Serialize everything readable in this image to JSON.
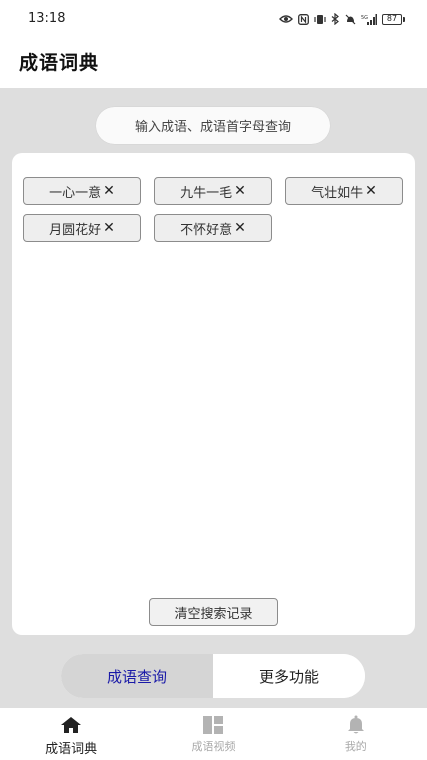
{
  "status_bar": {
    "time": "13:18",
    "battery": "87"
  },
  "header": {
    "title": "成语词典"
  },
  "search": {
    "placeholder": "输入成语、成语首字母查询"
  },
  "history": {
    "tags": [
      {
        "label": "一心一意"
      },
      {
        "label": "九牛一毛"
      },
      {
        "label": "气壮如牛"
      },
      {
        "label": "月圆花好"
      },
      {
        "label": "不怀好意"
      }
    ],
    "close_glyph": "✕",
    "clear_label": "清空搜索记录"
  },
  "segments": {
    "active_label": "成语查询",
    "inactive_label": "更多功能"
  },
  "bottom_nav": {
    "items": [
      {
        "label": "成语词典",
        "icon": "home-icon"
      },
      {
        "label": "成语视频",
        "icon": "grid-icon"
      },
      {
        "label": "我的",
        "icon": "bell-icon"
      }
    ]
  },
  "colors": {
    "active_segment_text": "#1a1aa8",
    "page_background": "#dedede"
  }
}
